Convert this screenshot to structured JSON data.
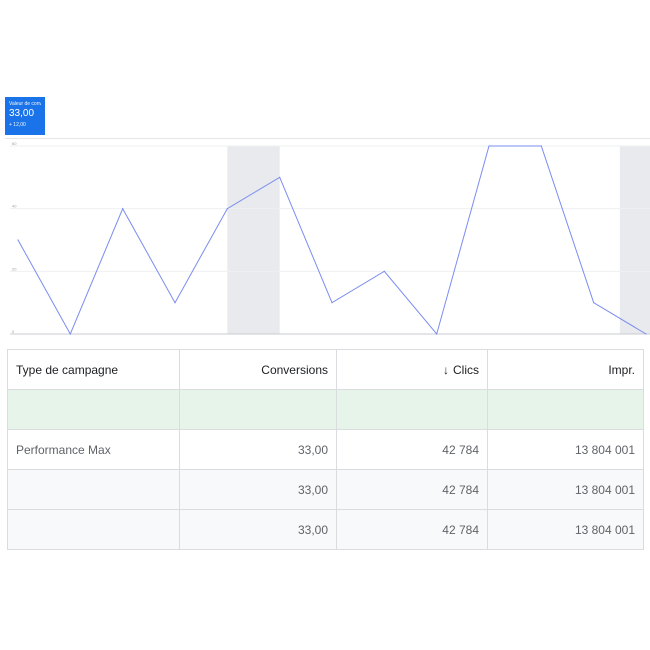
{
  "metric_card": {
    "label": "Valeur de conversion",
    "value": "33,00",
    "delta": "+ 12,00",
    "color": "#1a73e8"
  },
  "chart_data": {
    "type": "line",
    "x": [
      0,
      1,
      2,
      3,
      4,
      5,
      6,
      7,
      8,
      9,
      10,
      11,
      12
    ],
    "series": [
      {
        "values": [
          3,
          0,
          4,
          1,
          4,
          5,
          1,
          2,
          0,
          6,
          6,
          1,
          0
        ],
        "color": "#7b8cf0"
      }
    ],
    "ylim": [
      0,
      6
    ],
    "y_ticks": [
      "0",
      "20",
      "40",
      "60"
    ],
    "shaded_x": [
      4,
      11.5
    ],
    "grid": true
  },
  "table": {
    "columns": [
      {
        "label": "Type de campagne",
        "align": "left"
      },
      {
        "label": "Conversions",
        "align": "right"
      },
      {
        "label": "Clics",
        "align": "right",
        "sorted": "desc",
        "sort_icon": "↓"
      },
      {
        "label": "Impr.",
        "align": "right"
      }
    ],
    "rows": [
      {
        "style": "highlight",
        "cells": [
          "",
          "",
          "",
          ""
        ]
      },
      {
        "style": "plain",
        "cells": [
          "Performance Max",
          "33,00",
          "42 784",
          "13 804 001"
        ]
      },
      {
        "style": "alt",
        "cells": [
          "",
          "33,00",
          "42 784",
          "13 804 001"
        ]
      },
      {
        "style": "alt",
        "cells": [
          "",
          "33,00",
          "42 784",
          "13 804 001"
        ]
      }
    ]
  }
}
